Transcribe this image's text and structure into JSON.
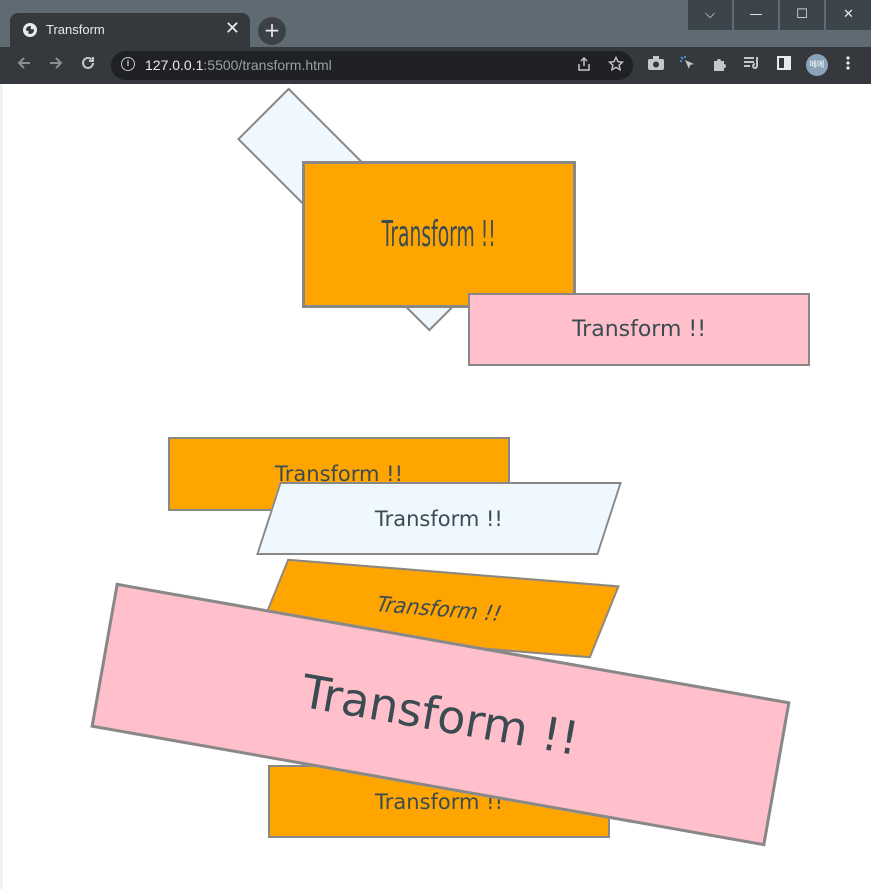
{
  "browser": {
    "tab_title": "Transform",
    "tab_close": "✕",
    "new_tab": "+",
    "url_host": "127.0.0.1",
    "url_rest": ":5500/transform.html",
    "avatar_text": "메메",
    "window_controls": {
      "dropdown": "⌵",
      "minimize": "—",
      "maximize": "☐",
      "close": "✕"
    }
  },
  "page": {
    "boxes": [
      {
        "id": "rotated-alice",
        "label": ""
      },
      {
        "id": "condensed-orange",
        "label": "Transform !!"
      },
      {
        "id": "pink-1",
        "label": "Transform !!"
      },
      {
        "id": "orange-2",
        "label": "Transform !!"
      },
      {
        "id": "skew-alice",
        "label": "Transform !!"
      },
      {
        "id": "skew-orange",
        "label": "Transform !!"
      },
      {
        "id": "big-pink",
        "label": "Transform !!"
      },
      {
        "id": "orange-bottom",
        "label": "Transform !!"
      }
    ]
  },
  "colors": {
    "orange": "#ffa500",
    "pink": "#ffc0cb",
    "alice": "#f0f8ff",
    "border": "#888888",
    "text": "#3a4b52"
  }
}
